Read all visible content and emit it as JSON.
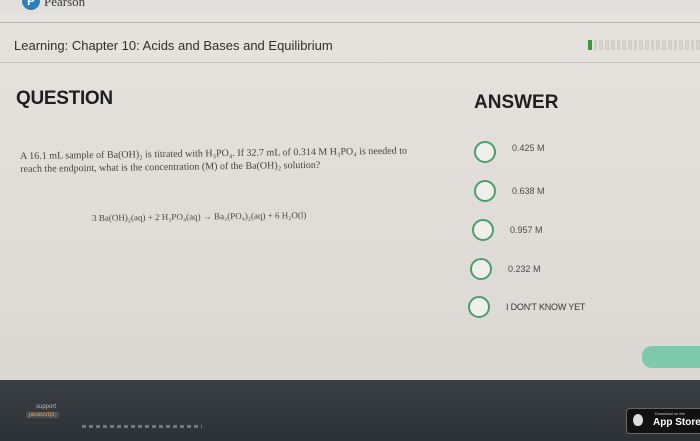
{
  "brand": {
    "name": "Pearson",
    "logo_letter": "P"
  },
  "header": {
    "chapter_title": "Learning: Chapter 10: Acids and Bases and Equilibrium",
    "progress_done_fraction": 0.05
  },
  "question": {
    "heading": "QUESTION",
    "text": "A 16.1 mL sample of Ba(OH)₂ is titrated with H₃PO₄. If 32.7 mL of 0.314 M H₃PO₄ is needed to reach the endpoint, what is the concentration (M) of the Ba(OH)₂ solution?",
    "equation": "3 Ba(OH)₂(aq) + 2 H₃PO₄(aq) → Ba₃(PO₄)₂(aq) + 6 H₂O(l)"
  },
  "answer": {
    "heading": "ANSWER",
    "options": [
      {
        "label": "0.425 M"
      },
      {
        "label": "0.638 M"
      },
      {
        "label": "0.957 M"
      },
      {
        "label": "0.232 M"
      },
      {
        "label": "I DON'T KNOW YET"
      }
    ]
  },
  "footer": {
    "support": "support",
    "javascript": "javascript;",
    "appstore_small": "Download on the",
    "appstore_big": "App Store"
  },
  "colors": {
    "radio_border": "#4aa06a",
    "progress_done": "#3a9a3a",
    "submit_button": "#7ec9ad",
    "footer_bg": "#2d3236"
  }
}
